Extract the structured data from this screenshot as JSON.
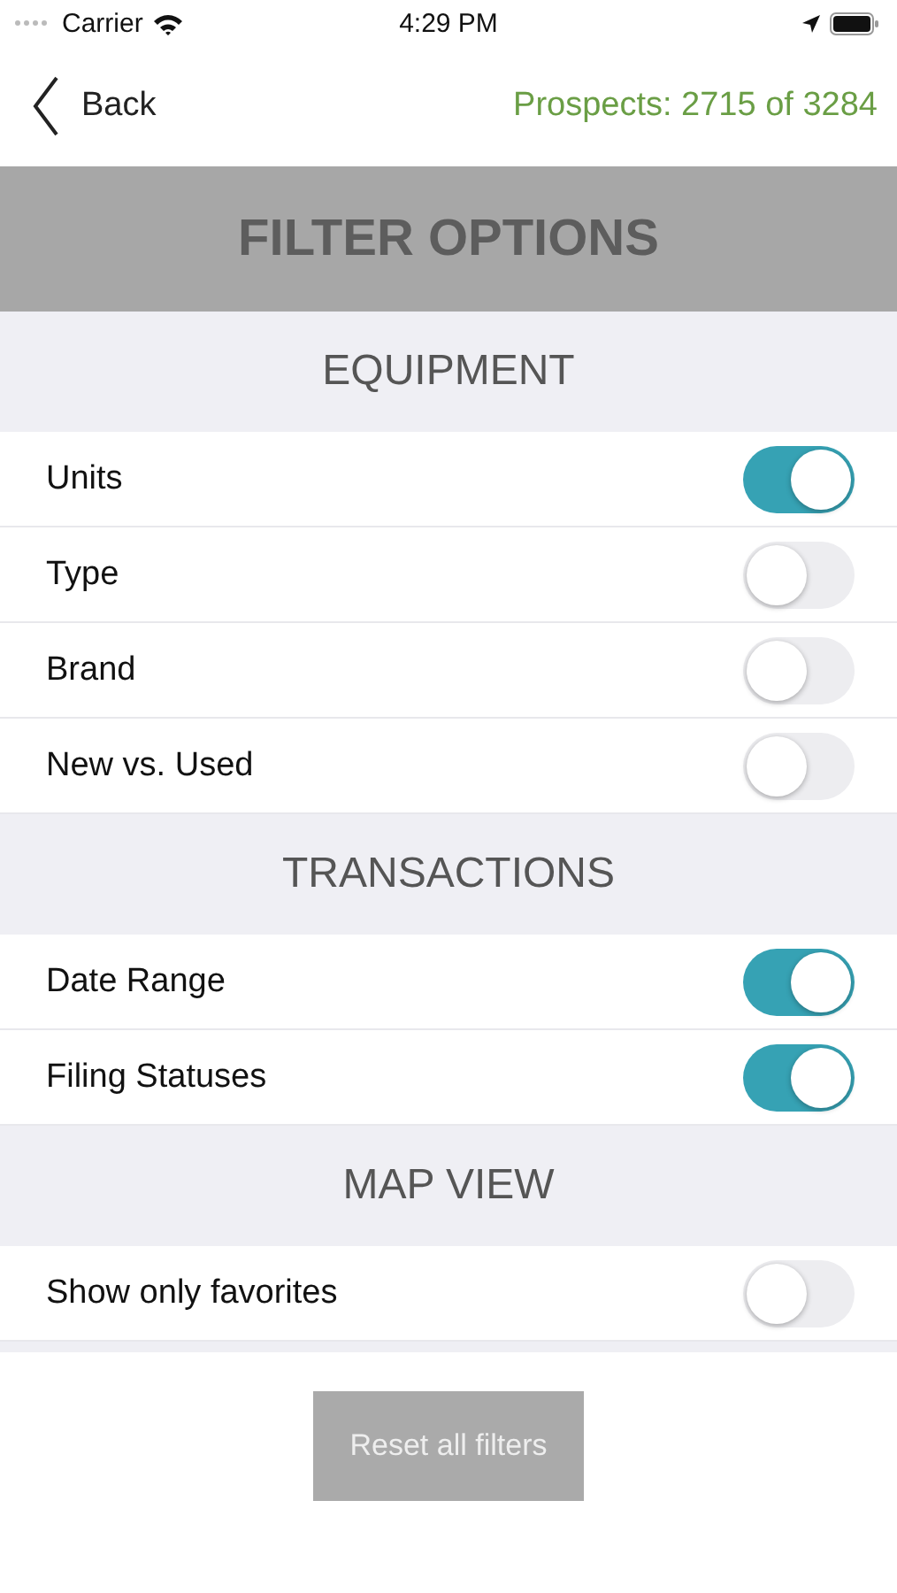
{
  "status_bar": {
    "carrier": "Carrier",
    "time": "4:29 PM"
  },
  "nav": {
    "back": "Back",
    "count": "Prospects: 2715 of 3284"
  },
  "title": "FILTER OPTIONS",
  "sections": [
    {
      "title": "EQUIPMENT",
      "items": [
        {
          "label": "Units",
          "on": true
        },
        {
          "label": "Type",
          "on": false
        },
        {
          "label": "Brand",
          "on": false
        },
        {
          "label": "New vs. Used",
          "on": false
        }
      ]
    },
    {
      "title": "TRANSACTIONS",
      "items": [
        {
          "label": "Date Range",
          "on": true
        },
        {
          "label": "Filing Statuses",
          "on": true
        }
      ]
    },
    {
      "title": "MAP VIEW",
      "items": [
        {
          "label": "Show only favorites",
          "on": false
        }
      ]
    }
  ],
  "reset_button": "Reset all filters"
}
